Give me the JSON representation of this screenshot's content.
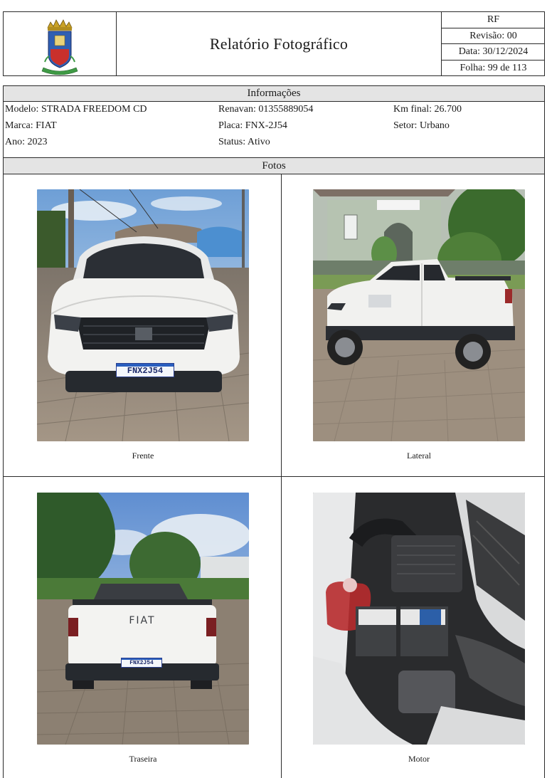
{
  "header": {
    "title": "Relatório Fotográfico",
    "doc_code": "RF",
    "revision": "Revisão: 00",
    "date": "Data: 30/12/2024",
    "sheet": "Folha: 99 de 113"
  },
  "info": {
    "section_title": "Informações",
    "modelo": "Modelo: STRADA FREEDOM CD",
    "marca": "Marca: FIAT",
    "ano": "Ano: 2023",
    "renavan": "Renavan: 01355889054",
    "placa": "Placa: FNX-2J54",
    "status": "Status: Ativo",
    "km_final": "Km final: 26.700",
    "setor": "Setor: Urbano"
  },
  "photos": {
    "section_title": "Fotos",
    "items": [
      {
        "caption": "Frente",
        "plate": "FNX2J54"
      },
      {
        "caption": "Lateral"
      },
      {
        "caption": "Traseira",
        "plate": "FNX2J54",
        "badge": "FIAT"
      },
      {
        "caption": "Motor"
      }
    ]
  },
  "colors": {
    "border": "#2a2a2a",
    "band": "#e4e4e4",
    "vehicle": "#f2f2f0",
    "pavement": "#8d8378",
    "sky": "#8fb6de"
  }
}
